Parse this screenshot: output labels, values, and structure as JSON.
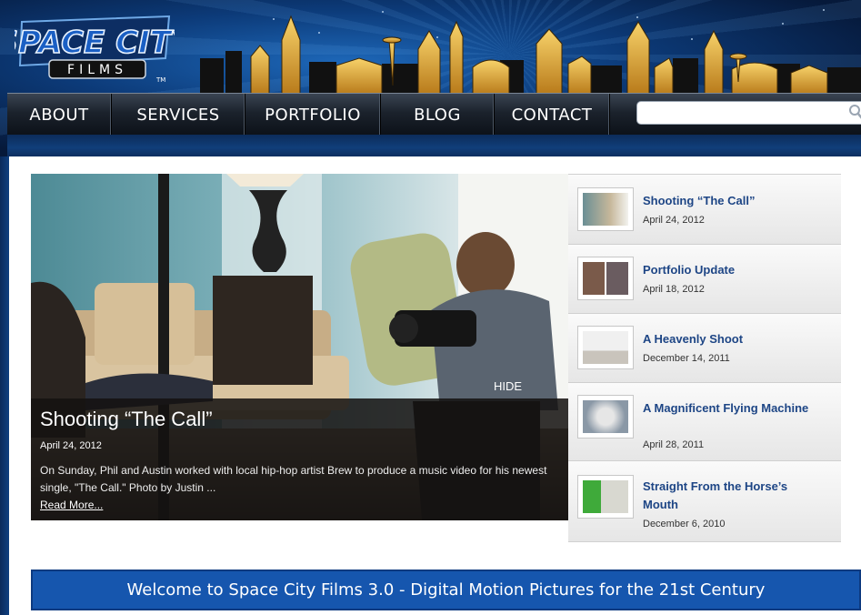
{
  "header": {
    "logo_text_main": "SPACE CITY",
    "logo_text_sub": "FILMS",
    "logo_tm": "TM"
  },
  "nav": {
    "items": [
      {
        "label": "ABOUT"
      },
      {
        "label": "SERVICES"
      },
      {
        "label": "PORTFOLIO"
      },
      {
        "label": "BLOG"
      },
      {
        "label": "CONTACT"
      }
    ],
    "search_placeholder": ""
  },
  "featured": {
    "title": "Shooting “The Call”",
    "date": "April 24, 2012",
    "excerpt": "On Sunday, Phil and Austin worked with local hip-hop artist Brew to produce a music video for his newest single, \"The Call.\" Photo by Justin ...",
    "read_more": "Read More...",
    "hide_label": "HIDE"
  },
  "posts": [
    {
      "title": "Shooting “The Call”",
      "date": "April 24, 2012"
    },
    {
      "title": "Portfolio Update",
      "date": "April 18, 2012"
    },
    {
      "title": "A Heavenly Shoot",
      "date": "December 14, 2011"
    },
    {
      "title": "A Magnificent Flying Machine",
      "date": "April 28, 2011"
    },
    {
      "title": "Straight From the Horse’s Mouth",
      "date": "December 6, 2010"
    }
  ],
  "welcome": {
    "text": "Welcome to Space City Films 3.0 - Digital Motion Pictures for the 21st Century"
  },
  "colors": {
    "nav_bg": "#1b222c",
    "link_blue": "#1d4585",
    "banner_blue": "#1656ae",
    "skyline_gold": "#e8b23a"
  }
}
